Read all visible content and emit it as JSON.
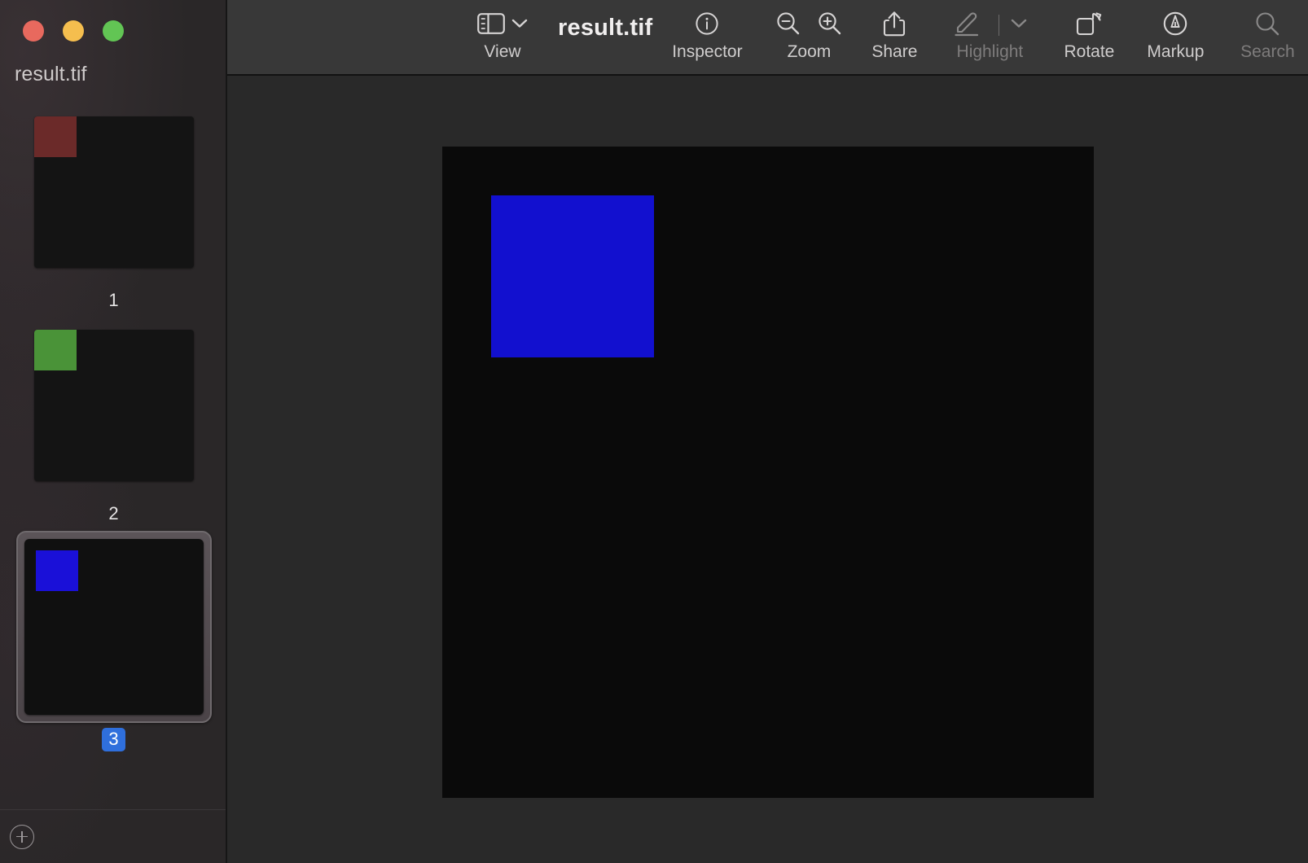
{
  "window": {
    "traffic_lights": [
      {
        "name": "close",
        "color": "#e8695e"
      },
      {
        "name": "minimize",
        "color": "#f5be4e"
      },
      {
        "name": "maximize",
        "color": "#62c554"
      }
    ]
  },
  "sidebar": {
    "title": "result.tif",
    "add_button_icon": "plus-circle-icon",
    "thumbnails": [
      {
        "label": "1",
        "swatch_color": "#6b2a29",
        "page_color": "#141414",
        "selected": false
      },
      {
        "label": "2",
        "swatch_color": "#4a9338",
        "page_color": "#141414",
        "selected": false
      },
      {
        "label": "3",
        "swatch_color": "#1a10d8",
        "page_color": "#101010",
        "selected": true
      }
    ]
  },
  "toolbar": {
    "view": {
      "label": "View",
      "icon": "sidebar-toggle-icon",
      "chevron": "chevron-down-icon"
    },
    "document_title": "result.tif",
    "inspector": {
      "label": "Inspector",
      "icon": "info-circle-icon"
    },
    "zoom": {
      "label": "Zoom",
      "zoom_out_icon": "magnifier-minus-icon",
      "zoom_in_icon": "magnifier-plus-icon"
    },
    "share": {
      "label": "Share",
      "icon": "share-arrow-up-icon"
    },
    "highlight": {
      "label": "Highlight",
      "icon": "highlighter-pen-icon",
      "chevron": "chevron-down-icon",
      "disabled": true
    },
    "rotate": {
      "label": "Rotate",
      "icon": "rotate-square-icon"
    },
    "markup": {
      "label": "Markup",
      "icon": "markup-pen-circle-icon"
    },
    "search": {
      "label": "Search",
      "icon": "magnifier-icon",
      "disabled": true
    }
  },
  "canvas": {
    "page_background": "#0a0a0a",
    "shape_color": "#1210cf",
    "shape_name": "blue-square"
  },
  "colors": {
    "accent": "#2f6fdc",
    "toolbar_bg": "#383838",
    "sidebar_bg": "#2a2728",
    "canvas_bg": "#292929"
  }
}
